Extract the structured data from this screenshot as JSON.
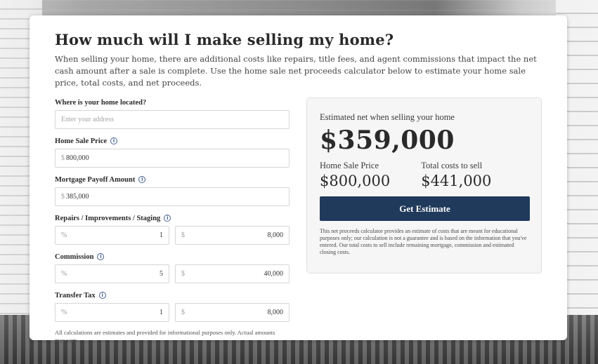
{
  "page": {
    "title": "How much will I make selling my home?",
    "intro": "When selling your home, there are additional costs like repairs, title fees, and agent commissions that impact the net cash amount after a sale is complete. Use the home sale net proceeds calculator below to estimate your home sale price, total costs, and net proceeds."
  },
  "form": {
    "location": {
      "label": "Where is your home located?",
      "placeholder": "Enter your address",
      "value": ""
    },
    "sale_price": {
      "label": "Home Sale Price",
      "prefix": "$",
      "value": "800,000"
    },
    "mortgage": {
      "label": "Mortgage Payoff Amount",
      "prefix": "$",
      "value": "385,000"
    },
    "repairs": {
      "label": "Repairs / Improvements / Staging",
      "pct_prefix": "%",
      "pct_value": "1",
      "amt_prefix": "$",
      "amt_value": "8,000"
    },
    "commission": {
      "label": "Commission",
      "pct_prefix": "%",
      "pct_value": "5",
      "amt_prefix": "$",
      "amt_value": "40,000"
    },
    "transfer_tax": {
      "label": "Transfer Tax",
      "pct_prefix": "%",
      "pct_value": "1",
      "amt_prefix": "$",
      "amt_value": "8,000"
    },
    "disclaimer": "All calculations are estimates and provided for informational purposes only. Actual amounts may vary."
  },
  "results": {
    "title": "Estimated net when selling your home",
    "net": "$359,000",
    "sale_price_label": "Home Sale Price",
    "sale_price_value": "$800,000",
    "costs_label": "Total costs to sell",
    "costs_value": "$441,000",
    "cta": "Get Estimate",
    "note": "This net proceeds calculator provides an estimate of costs that are meant for educational purposes only; our calculation is not a guarantee and is based on the information that you've entered. Our total costs to sell include remaining mortgage, commission and estimated closing costs."
  },
  "icons": {
    "info": "info-icon",
    "info_glyph": "i"
  },
  "colors": {
    "accent": "#203a5c",
    "icon": "#44608f"
  }
}
